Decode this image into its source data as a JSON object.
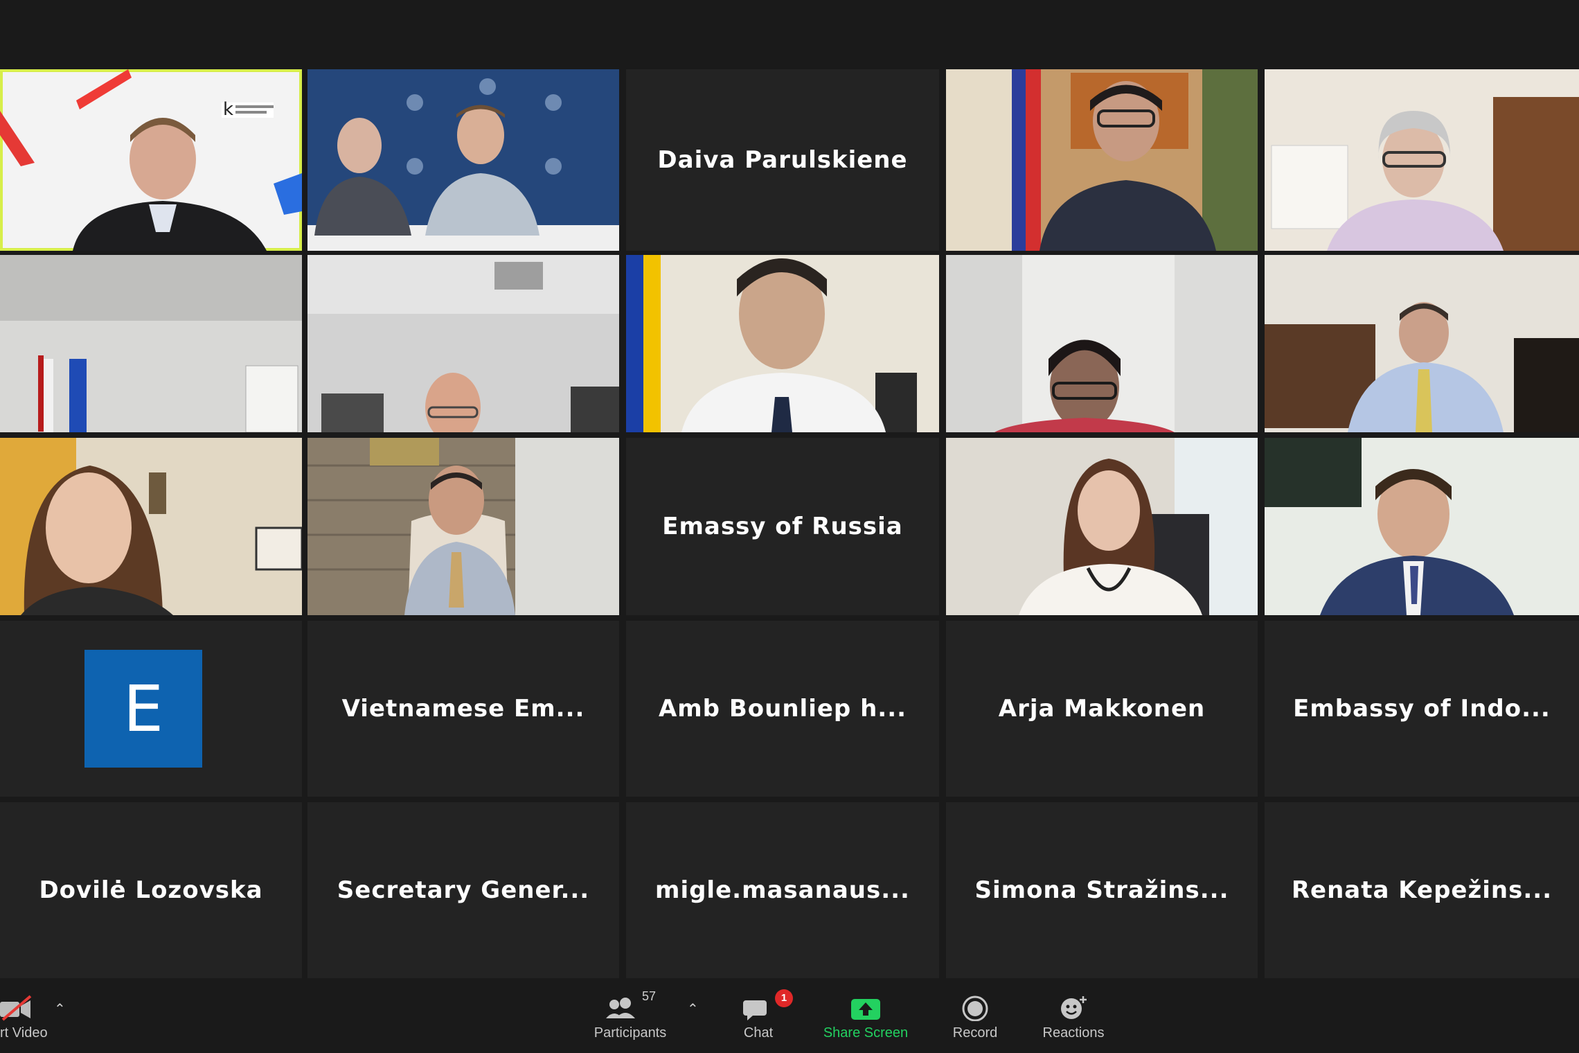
{
  "grid": {
    "name_tiles": {
      "t2": "Daiva Parulskiene",
      "t12": "Emassy of Russia",
      "t16": "Vietnamese Em...",
      "t17": "Amb Bounliep h...",
      "t18": "Arja Makkonen",
      "t19": "Embassy of Indo...",
      "t20": "Dovilė Lozovska",
      "t21": "Secretary Gener...",
      "t22": "migle.masanaus...",
      "t23": "Simona Stražins...",
      "t24": "Renata Kepežins..."
    },
    "avatar_letter": "E"
  },
  "toolbar": {
    "start_video": "rt Video",
    "participants": "Participants",
    "participants_count": "57",
    "chat": "Chat",
    "chat_badge": "1",
    "share_screen": "Share Screen",
    "record": "Record",
    "reactions": "Reactions"
  },
  "colors": {
    "active_speaker_border": "#d7ee4a",
    "share_green": "#23d160",
    "avatar_blue": "#0e63b0",
    "badge_red": "#e02828"
  }
}
